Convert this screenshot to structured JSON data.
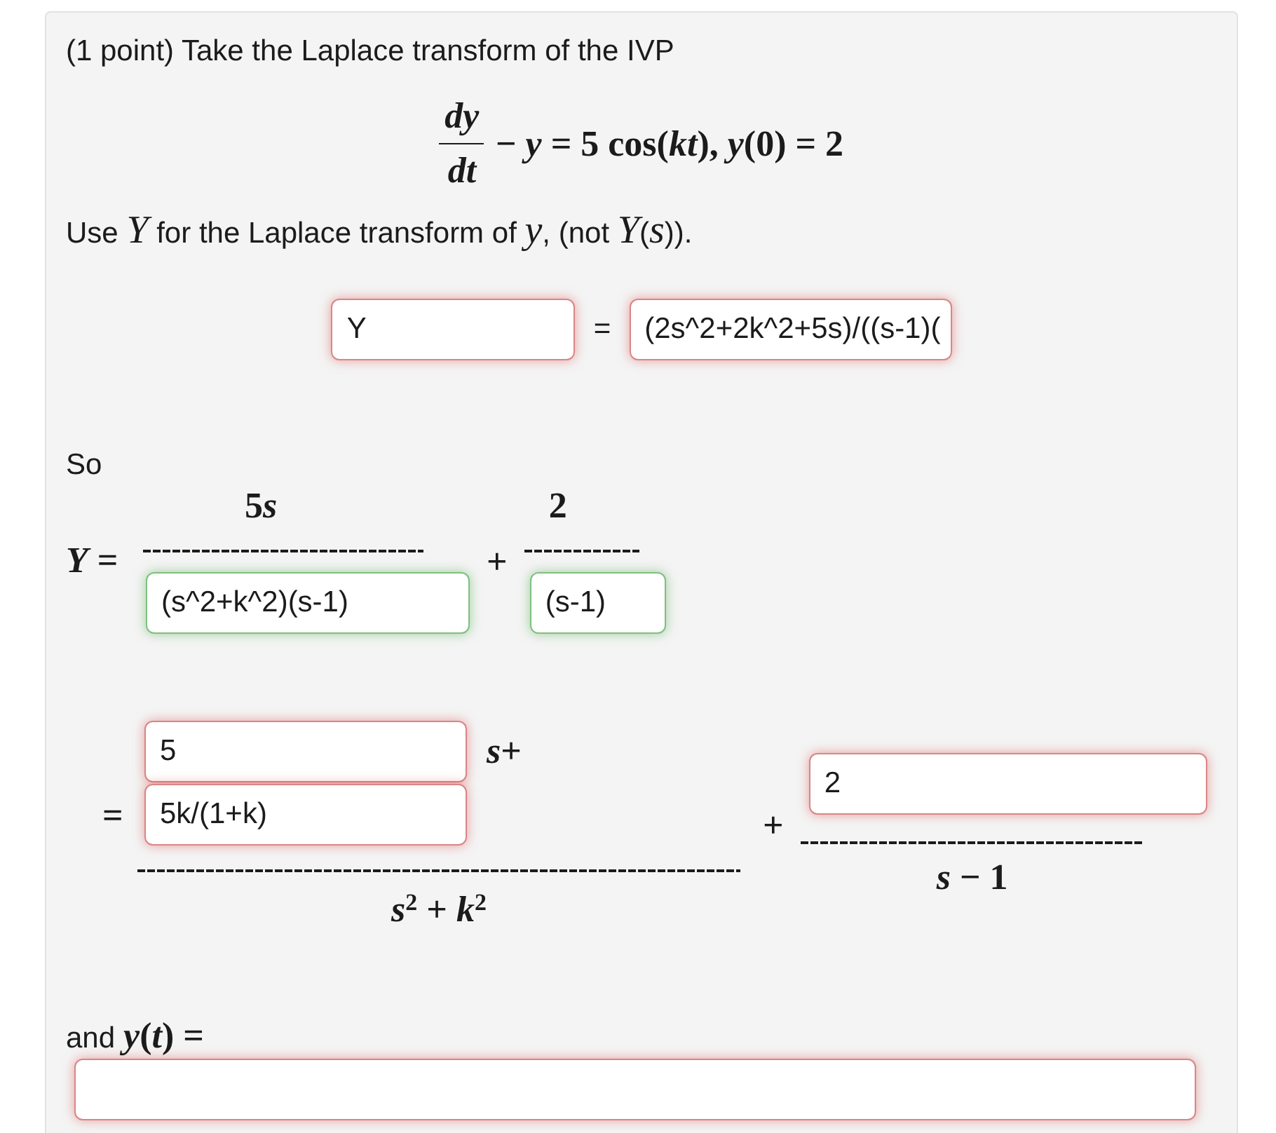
{
  "intro": "(1 point) Take the Laplace transform of the IVP",
  "ivp": {
    "numerator": "dy",
    "denominator": "dt",
    "rest": "− *y* = 5 cos(*kt*), *y*(0) = 2"
  },
  "instruction": "Use *Y* for the Laplace transform of *y*, (not *Y*(*s*)).",
  "transform_row": {
    "fields": [
      {
        "value": "Y",
        "correct": false
      },
      {
        "value": "(2s^2+2k^2+5s)/((s-1)(",
        "correct": false
      }
    ],
    "equals": "="
  },
  "so_label": "So",
  "decomposition": {
    "lhs": "*Y* =",
    "terms": [
      {
        "numerator": {
          "number": "5",
          "variable": "s"
        },
        "field": {
          "value": "(s^2+k^2)(s-1)",
          "correct": true
        }
      },
      {
        "operator": "+",
        "numerator": {
          "number": "2"
        },
        "field": {
          "value": "(s-1)",
          "correct": true
        }
      }
    ]
  },
  "partial_fractions": {
    "lhs": "=",
    "first_term": {
      "fields": [
        {
          "value": "5",
          "correct": false
        },
        {
          "value": "5k/(1+k)",
          "correct": false
        }
      ],
      "between": "*s*+",
      "denominator": "*s*$^{2}$ + *k*$^{2}$"
    },
    "operator": "+",
    "second_term": {
      "field": {
        "value": "2",
        "correct": false
      },
      "denominator": "*s* − 1"
    }
  },
  "solution": {
    "label": "and",
    "math": "*y*(*t*) =",
    "field": {
      "correct": false
    }
  }
}
